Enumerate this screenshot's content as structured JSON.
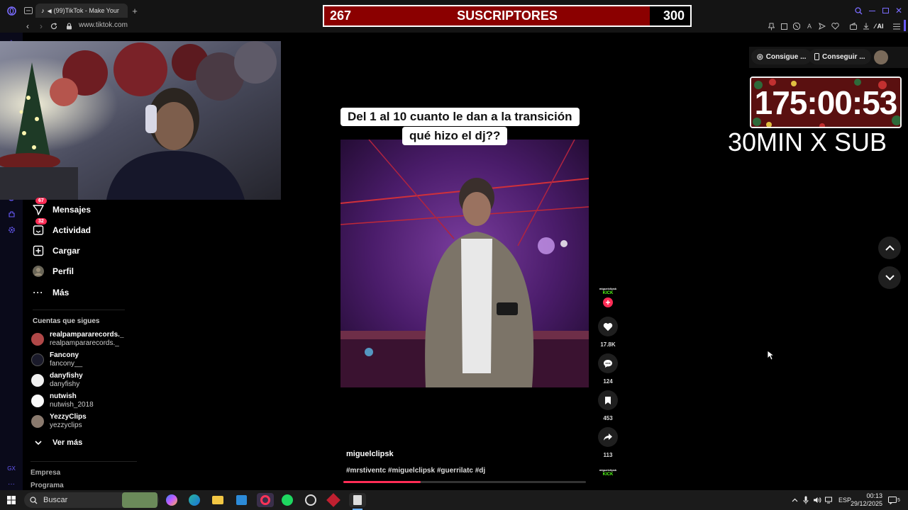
{
  "browser": {
    "tab_title": "(99)TikTok - Make Your",
    "new_tab_symbol": "+",
    "url": "www.tiktok.com",
    "ai_label": "AI"
  },
  "overlay": {
    "sub_current": "267",
    "sub_label": "SUSCRIPTORES",
    "sub_goal": "300",
    "sub_progress": 0.89,
    "timer": "175:00:53",
    "rate": "30MIN X SUB",
    "bar_color": "#8b0000"
  },
  "tiktok": {
    "nav": [
      {
        "label": "Mensajes",
        "badge": "67",
        "icon": "send-icon"
      },
      {
        "label": "Actividad",
        "badge": "32",
        "icon": "inbox-icon"
      },
      {
        "label": "Cargar",
        "icon": "upload-icon"
      },
      {
        "label": "Perfil",
        "icon": "avatar-icon"
      },
      {
        "label": "Más",
        "icon": "more-icon"
      }
    ],
    "following_title": "Cuentas que sigues",
    "following": [
      {
        "name": "realpampararecords._",
        "user": "realpampararecords._"
      },
      {
        "name": "Fancony",
        "user": "fancony__"
      },
      {
        "name": "danyfishy",
        "user": "danyfishy"
      },
      {
        "name": "nutwish",
        "user": "nutwish_2018"
      },
      {
        "name": "YezzyClips",
        "user": "yezzyclips"
      }
    ],
    "see_more": "Ver más",
    "footer": [
      "Empresa",
      "Programa"
    ],
    "header_pills": [
      "Consigue ...",
      "Conseguir ..."
    ]
  },
  "video": {
    "caption_line1": "Del 1 al 10 cuanto le dan a la transición",
    "caption_line2": "qué hizo el dj??",
    "author": "miguelclipsk",
    "hashtags": "#mrstiventc #miguelclipsk #guerrilatc #dj",
    "likes": "17.8K",
    "comments": "124",
    "saves": "453",
    "shares": "113",
    "progress": 0.32,
    "accent": "#fe2c55"
  },
  "taskbar": {
    "search_label": "Buscar",
    "lang": "ESP",
    "time": "00:13",
    "date": "29/12/2025",
    "notif_count": "5"
  }
}
